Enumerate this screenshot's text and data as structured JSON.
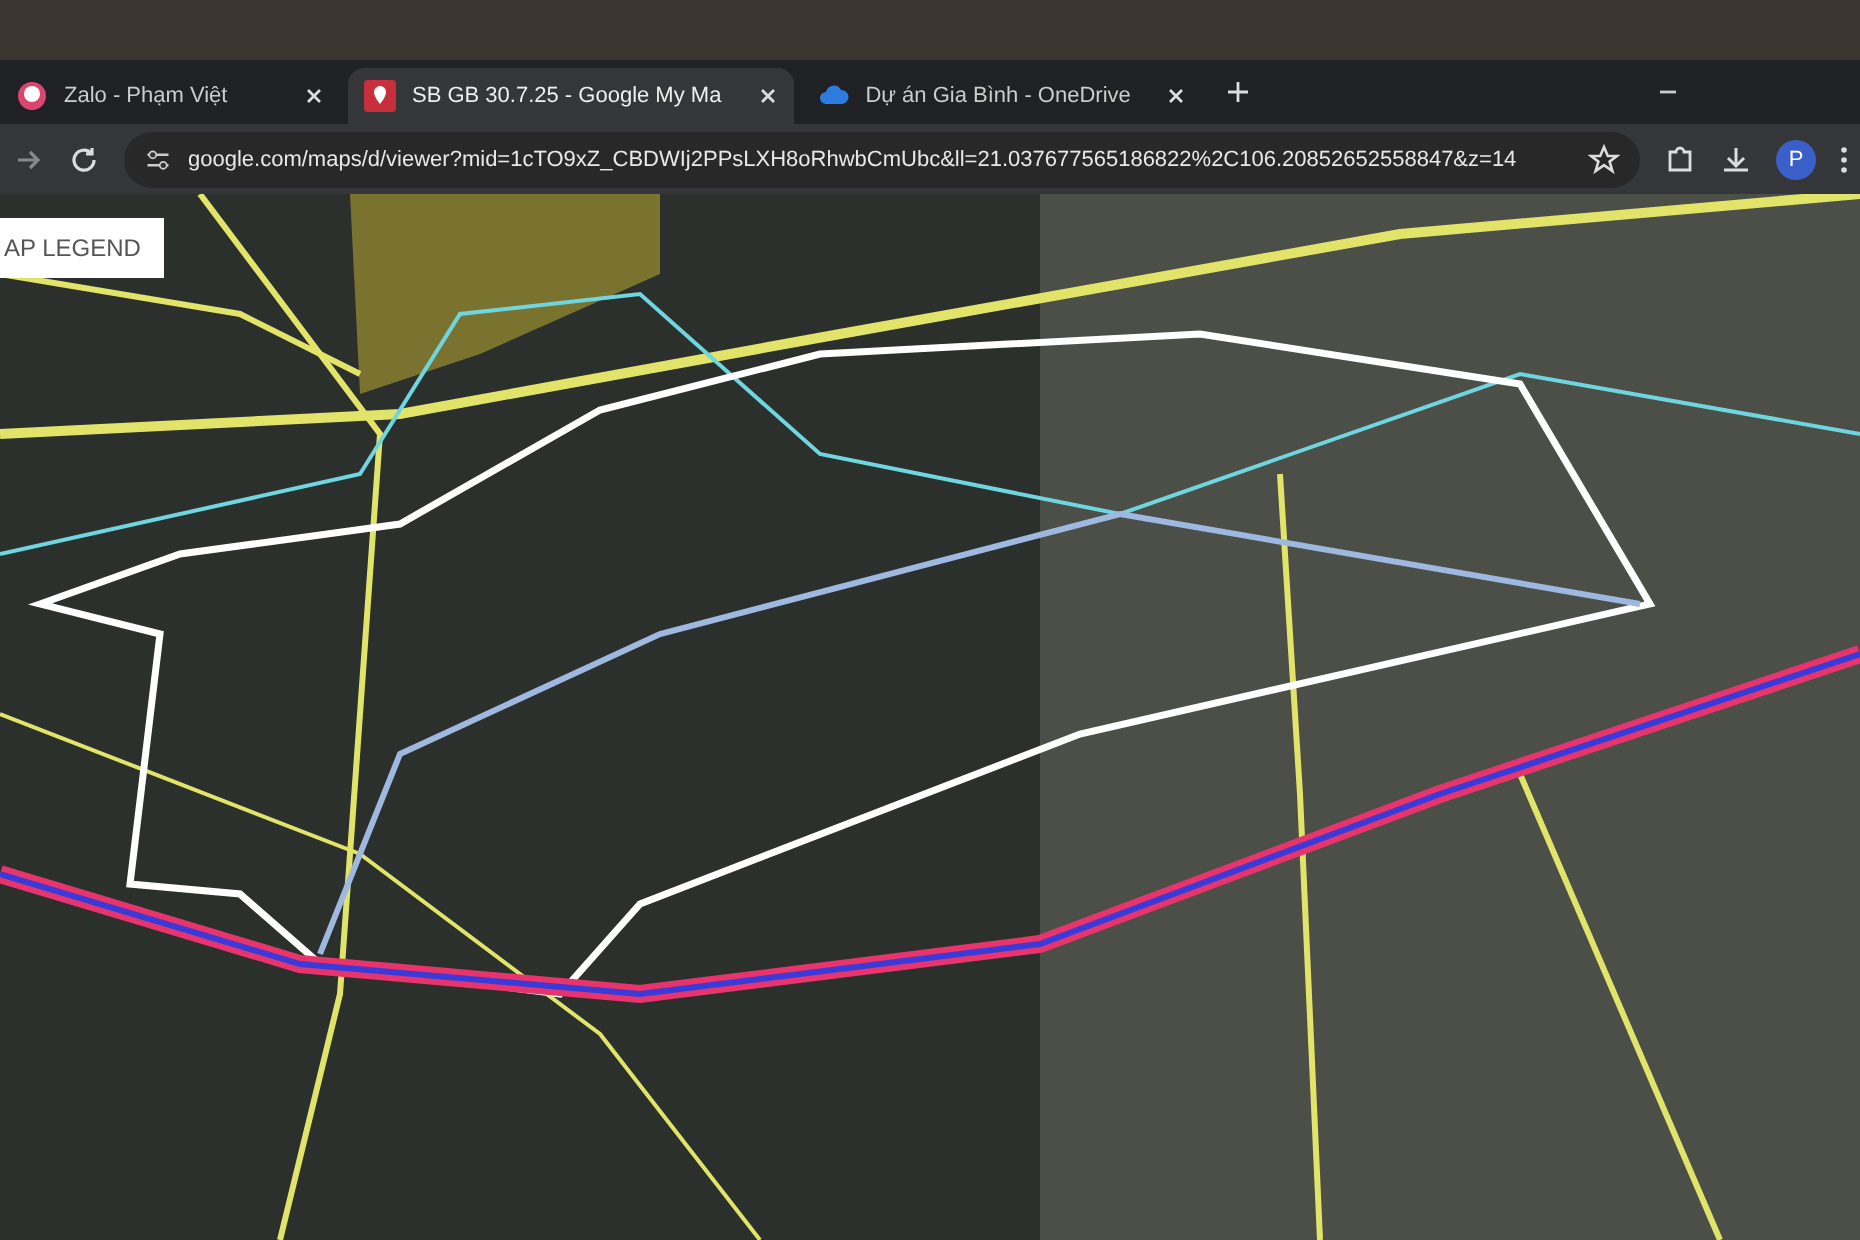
{
  "tabs": [
    {
      "title": "Zalo - Phạm Việt",
      "selected": false
    },
    {
      "title": "SB GB 30.7.25 - Google My Ma",
      "selected": true
    },
    {
      "title": "Dự án Gia Bình - OneDrive",
      "selected": false
    }
  ],
  "address_bar": {
    "url": "google.com/maps/d/viewer?mid=1cTO9xZ_CBDWIj2PPsLXH8oRhwbCmUbc&ll=21.037677565186822%2C106.20852652558847&z=14"
  },
  "profile": {
    "initial": "P"
  },
  "map": {
    "legend_button": "AP LEGEND"
  }
}
